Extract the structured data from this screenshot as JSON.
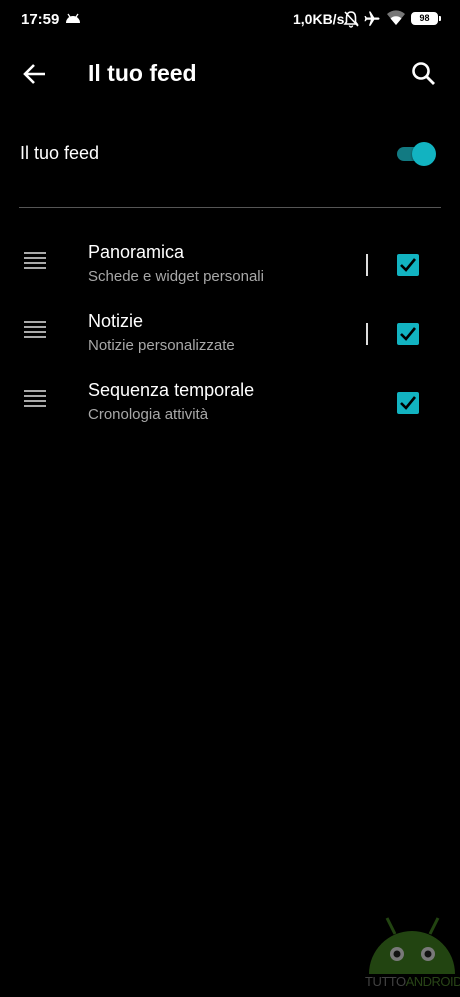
{
  "status_bar": {
    "time": "17:59",
    "net_speed": "1,0KB/s",
    "battery": "98"
  },
  "app_bar": {
    "title": "Il tuo feed",
    "back_icon": "arrow-back-icon",
    "search_icon": "search-icon"
  },
  "feed_toggle": {
    "label": "Il tuo feed",
    "enabled": true,
    "accent": "#12b3c1"
  },
  "items": [
    {
      "title": "Panoramica",
      "subtitle": "Schede e widget personali",
      "checked": true
    },
    {
      "title": "Notizie",
      "subtitle": "Notizie personalizzate",
      "checked": true
    },
    {
      "title": "Sequenza temporale",
      "subtitle": "Cronologia attività",
      "checked": true
    }
  ],
  "watermark": {
    "part1": "TUTTO",
    "part2": "ANDROID"
  },
  "colors": {
    "background": "#000000",
    "accent": "#12b3c1",
    "secondary_text": "#a8a8a8"
  }
}
